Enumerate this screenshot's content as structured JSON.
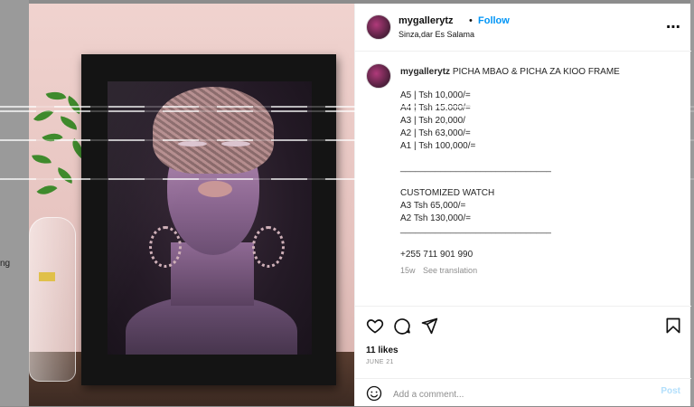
{
  "backdrop": {
    "side_text": "ng"
  },
  "post": {
    "username": "mygallerytz",
    "separator": "•",
    "follow_label": "Follow",
    "location": "Sinza,dar Es Salama",
    "more_icon": "more-horizontal-icon"
  },
  "caption": {
    "username": "mygallerytz",
    "title": "PICHA MBAO & PICHA ZA KIOO FRAME",
    "prices": [
      "A5 | Tsh 10,000/=",
      "A4 | Tsh 15,000/=",
      "A3 | Tsh 20,000/",
      "A2 | Tsh 63,000/=",
      "A1 | Tsh 100,000/="
    ],
    "rule1": "______________________________",
    "custom_title": "CUSTOMIZED WATCH",
    "custom_prices": [
      "A3 Tsh 65,000/=",
      "A2 Tsh 130,000/="
    ],
    "rule2": "______________________________",
    "phone": "+255 711 901 990",
    "age": "15w",
    "see_translation": "See translation"
  },
  "actions": {
    "like_icon": "heart-icon",
    "comment_icon": "comment-icon",
    "share_icon": "share-icon",
    "save_icon": "bookmark-icon"
  },
  "likes": "11 likes",
  "date": "JUNE 21",
  "comment": {
    "placeholder": "Add a comment...",
    "post_label": "Post",
    "emoji_icon": "emoji-icon"
  },
  "colors": {
    "accent": "#0095f6",
    "post_disabled": "#b2dffc",
    "text": "#262626",
    "muted": "#8e8e8e"
  }
}
